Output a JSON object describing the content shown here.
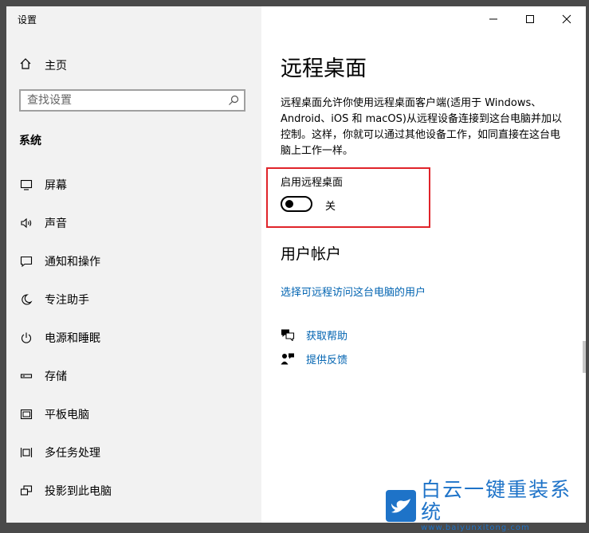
{
  "window": {
    "title": "设置"
  },
  "sidebar": {
    "home_label": "主页",
    "search_placeholder": "查找设置",
    "section_title": "系统",
    "items": [
      {
        "label": "屏幕",
        "icon": "monitor-icon"
      },
      {
        "label": "声音",
        "icon": "speaker-icon"
      },
      {
        "label": "通知和操作",
        "icon": "notification-icon"
      },
      {
        "label": "专注助手",
        "icon": "moon-icon"
      },
      {
        "label": "电源和睡眠",
        "icon": "power-icon"
      },
      {
        "label": "存储",
        "icon": "storage-icon"
      },
      {
        "label": "平板电脑",
        "icon": "tablet-icon"
      },
      {
        "label": "多任务处理",
        "icon": "multitask-icon"
      },
      {
        "label": "投影到此电脑",
        "icon": "project-icon"
      }
    ]
  },
  "main": {
    "title": "远程桌面",
    "description": "远程桌面允许你使用远程桌面客户端(适用于 Windows、Android、iOS 和 macOS)从远程设备连接到这台电脑并加以控制。这样，你就可以通过其他设备工作，如同直接在这台电脑上工作一样。",
    "toggle_label": "启用远程桌面",
    "toggle_state": "关",
    "toggle_on": false,
    "accounts_title": "用户帐户",
    "accounts_link": "选择可远程访问这台电脑的用户",
    "help_link": "获取帮助",
    "feedback_link": "提供反馈",
    "highlight_color": "#e0242a",
    "link_color": "#0063b1"
  },
  "watermark": {
    "title": "白云一键重装系统",
    "url": "www.baiyunxitong.com"
  }
}
